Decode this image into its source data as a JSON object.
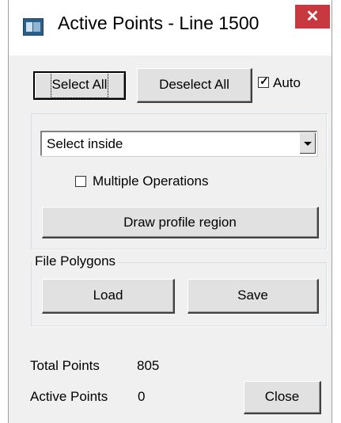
{
  "window": {
    "title": "Active Points - Line 1500",
    "close_icon": "close-icon",
    "close_glyph": "✕"
  },
  "toolbar": {
    "select_all_label": "Select All",
    "deselect_all_label": "Deselect All",
    "auto_label": "Auto",
    "auto_checked": true
  },
  "selection": {
    "mode_value": "Select inside",
    "multiple_operations_label": "Multiple Operations",
    "multiple_operations_checked": false,
    "draw_button_label": "Draw profile region"
  },
  "file_polygons": {
    "group_label": "File Polygons",
    "load_label": "Load",
    "save_label": "Save"
  },
  "stats": {
    "total_label": "Total Points",
    "total_value": "805",
    "active_label": "Active Points",
    "active_value": "0"
  },
  "footer": {
    "close_label": "Close"
  },
  "colors": {
    "title_close_bg": "#c7393f",
    "dialog_bg": "#f0f0f0",
    "button_face": "#e1e1e1"
  }
}
